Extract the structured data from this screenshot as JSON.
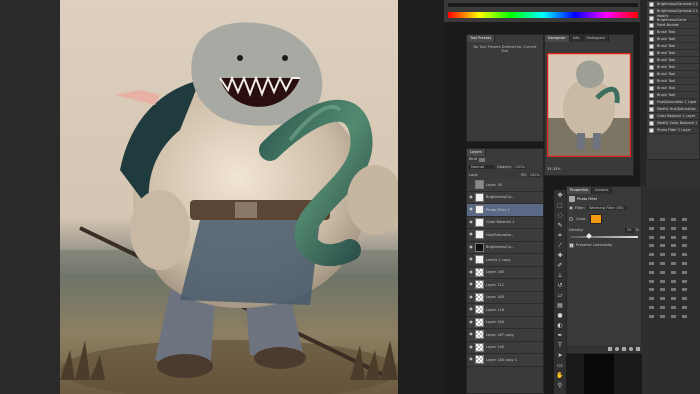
{
  "history": {
    "items": [
      {
        "label": "Brightness/Contrast 1 L"
      },
      {
        "label": "Brightness/Contrast 1 L"
      },
      {
        "label": "Modify Brightness/Contr"
      },
      {
        "label": "Paint Bucket"
      },
      {
        "label": "Brush Tool"
      },
      {
        "label": "Brush Tool"
      },
      {
        "label": "Brush Tool"
      },
      {
        "label": "Brush Tool"
      },
      {
        "label": "Brush Tool"
      },
      {
        "label": "Brush Tool"
      },
      {
        "label": "Brush Tool"
      },
      {
        "label": "Brush Tool"
      },
      {
        "label": "Brush Tool"
      },
      {
        "label": "Brush Tool"
      },
      {
        "label": "Hue/Saturation 1 Laye"
      },
      {
        "label": "Modify Hue/Saturation"
      },
      {
        "label": "Color Balance 1 Layer"
      },
      {
        "label": "Modify Color Balance 1"
      },
      {
        "label": "Photo Filter 1 Layer"
      }
    ]
  },
  "tool_presets": {
    "tab": "Tool Presets",
    "message": "No Tool Presets Defined for Current Tool."
  },
  "navigator": {
    "tabs": [
      "Navigator",
      "Info",
      "Histogram"
    ],
    "zoom": "33.33%"
  },
  "layers": {
    "tabs": [
      "Layers"
    ],
    "kind_label": "Kind",
    "blend_mode": "Normal",
    "opacity_label": "Opacity:",
    "opacity_value": "100%",
    "lock_label": "Lock:",
    "fill_label": "Fill:",
    "fill_value": "100%",
    "rows": [
      {
        "name": "Layer 18",
        "thumb": "grey",
        "visible": false
      },
      {
        "name": "Brightness/Co...",
        "thumb": "white",
        "visible": true
      },
      {
        "name": "Photo Filter 1",
        "thumb": "white",
        "visible": true
      },
      {
        "name": "Color Balance 1",
        "thumb": "white",
        "visible": true
      },
      {
        "name": "Hue/Saturatio...",
        "thumb": "white",
        "visible": true
      },
      {
        "name": "Brightness/Co...",
        "thumb": "black",
        "visible": true
      },
      {
        "name": "Levels 1 copy",
        "thumb": "white",
        "visible": true
      },
      {
        "name": "Layer 165",
        "thumb": "checker",
        "visible": true
      },
      {
        "name": "Layer 111",
        "thumb": "checker",
        "visible": true
      },
      {
        "name": "Layer 163",
        "thumb": "checker",
        "visible": true
      },
      {
        "name": "Layer 116",
        "thumb": "checker",
        "visible": true
      },
      {
        "name": "Layer 164",
        "thumb": "checker",
        "visible": true
      },
      {
        "name": "Layer 167 copy",
        "thumb": "checker",
        "visible": true
      },
      {
        "name": "Layer 140",
        "thumb": "checker",
        "visible": true
      },
      {
        "name": "Layer 140 copy 1",
        "thumb": "checker",
        "visible": true
      }
    ]
  },
  "properties": {
    "tabs": [
      "Properties",
      "Actions"
    ],
    "title": "Photo Filter",
    "filter_label": "Filter:",
    "filter_value": "Warming Filter (85)",
    "color_label": "Color:",
    "color_value": "#f39a12",
    "density_label": "Density:",
    "density_value": "25",
    "density_unit": "%",
    "density_fraction": 0.25,
    "preserve_label": "Preserve Luminosity",
    "preserve_checked": true
  },
  "colors": {
    "canvas_bg": "#2b2b2b",
    "panel_bg": "#3a3a3a",
    "selection": "#5a6a86",
    "nav_frame": "#e2231a"
  }
}
